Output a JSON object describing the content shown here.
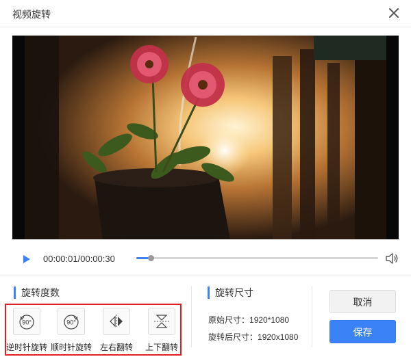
{
  "window": {
    "title": "视频旋转"
  },
  "player": {
    "current_time": "00:00:01",
    "separator": "/",
    "duration": "00:00:30",
    "time_display": "00:00:01/00:00:30",
    "progress": 0.06
  },
  "rotation": {
    "title": "旋转度数",
    "items": [
      {
        "label": "逆时针旋转",
        "icon": "rotate-ccw-90-icon",
        "icon_text": "90°"
      },
      {
        "label": "顺时针旋转",
        "icon": "rotate-cw-90-icon",
        "icon_text": "90°"
      },
      {
        "label": "左右翻转",
        "icon": "flip-horizontal-icon"
      },
      {
        "label": "上下翻转",
        "icon": "flip-vertical-icon"
      }
    ]
  },
  "size": {
    "title": "旋转尺寸",
    "original_label": "原始尺寸：",
    "original_value": "1920*1080",
    "rotated_label": "旋转后尺寸：",
    "rotated_value": "1920x1080"
  },
  "buttons": {
    "cancel": "取消",
    "save": "保存"
  },
  "colors": {
    "accent": "#3b82f6",
    "highlight_border": "#e02020"
  }
}
